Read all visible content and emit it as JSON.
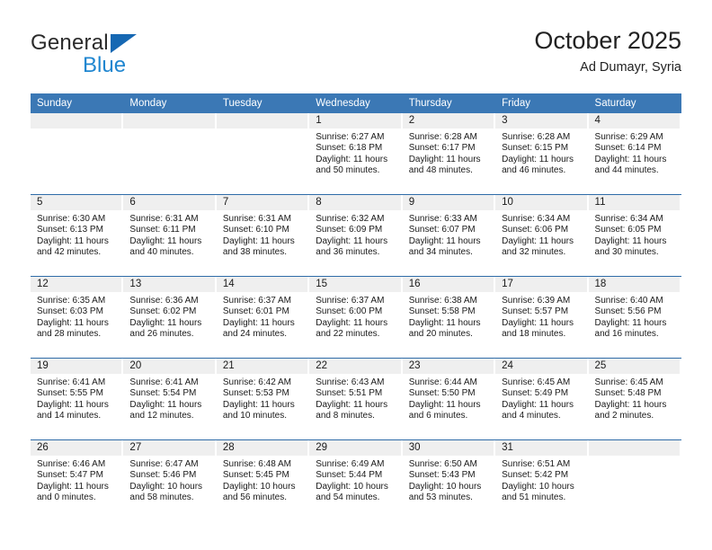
{
  "brand": {
    "name_top": "General",
    "name_bottom": "Blue",
    "accent_dark": "#1668b3",
    "accent_light": "#1f86d0"
  },
  "header": {
    "title": "October 2025",
    "subtitle": "Ad Dumayr, Syria"
  },
  "theme": {
    "header_blue": "#3b78b5",
    "row_divider_blue": "#2f6ca8",
    "day_band_gray": "#efefef"
  },
  "weekdays": [
    "Sunday",
    "Monday",
    "Tuesday",
    "Wednesday",
    "Thursday",
    "Friday",
    "Saturday"
  ],
  "weeks": [
    [
      {
        "day": "",
        "empty": true
      },
      {
        "day": "",
        "empty": true
      },
      {
        "day": "",
        "empty": true
      },
      {
        "day": "1",
        "sunrise": "Sunrise: 6:27 AM",
        "sunset": "Sunset: 6:18 PM",
        "daylight_1": "Daylight: 11 hours",
        "daylight_2": "and 50 minutes."
      },
      {
        "day": "2",
        "sunrise": "Sunrise: 6:28 AM",
        "sunset": "Sunset: 6:17 PM",
        "daylight_1": "Daylight: 11 hours",
        "daylight_2": "and 48 minutes."
      },
      {
        "day": "3",
        "sunrise": "Sunrise: 6:28 AM",
        "sunset": "Sunset: 6:15 PM",
        "daylight_1": "Daylight: 11 hours",
        "daylight_2": "and 46 minutes."
      },
      {
        "day": "4",
        "sunrise": "Sunrise: 6:29 AM",
        "sunset": "Sunset: 6:14 PM",
        "daylight_1": "Daylight: 11 hours",
        "daylight_2": "and 44 minutes."
      }
    ],
    [
      {
        "day": "5",
        "sunrise": "Sunrise: 6:30 AM",
        "sunset": "Sunset: 6:13 PM",
        "daylight_1": "Daylight: 11 hours",
        "daylight_2": "and 42 minutes."
      },
      {
        "day": "6",
        "sunrise": "Sunrise: 6:31 AM",
        "sunset": "Sunset: 6:11 PM",
        "daylight_1": "Daylight: 11 hours",
        "daylight_2": "and 40 minutes."
      },
      {
        "day": "7",
        "sunrise": "Sunrise: 6:31 AM",
        "sunset": "Sunset: 6:10 PM",
        "daylight_1": "Daylight: 11 hours",
        "daylight_2": "and 38 minutes."
      },
      {
        "day": "8",
        "sunrise": "Sunrise: 6:32 AM",
        "sunset": "Sunset: 6:09 PM",
        "daylight_1": "Daylight: 11 hours",
        "daylight_2": "and 36 minutes."
      },
      {
        "day": "9",
        "sunrise": "Sunrise: 6:33 AM",
        "sunset": "Sunset: 6:07 PM",
        "daylight_1": "Daylight: 11 hours",
        "daylight_2": "and 34 minutes."
      },
      {
        "day": "10",
        "sunrise": "Sunrise: 6:34 AM",
        "sunset": "Sunset: 6:06 PM",
        "daylight_1": "Daylight: 11 hours",
        "daylight_2": "and 32 minutes."
      },
      {
        "day": "11",
        "sunrise": "Sunrise: 6:34 AM",
        "sunset": "Sunset: 6:05 PM",
        "daylight_1": "Daylight: 11 hours",
        "daylight_2": "and 30 minutes."
      }
    ],
    [
      {
        "day": "12",
        "sunrise": "Sunrise: 6:35 AM",
        "sunset": "Sunset: 6:03 PM",
        "daylight_1": "Daylight: 11 hours",
        "daylight_2": "and 28 minutes."
      },
      {
        "day": "13",
        "sunrise": "Sunrise: 6:36 AM",
        "sunset": "Sunset: 6:02 PM",
        "daylight_1": "Daylight: 11 hours",
        "daylight_2": "and 26 minutes."
      },
      {
        "day": "14",
        "sunrise": "Sunrise: 6:37 AM",
        "sunset": "Sunset: 6:01 PM",
        "daylight_1": "Daylight: 11 hours",
        "daylight_2": "and 24 minutes."
      },
      {
        "day": "15",
        "sunrise": "Sunrise: 6:37 AM",
        "sunset": "Sunset: 6:00 PM",
        "daylight_1": "Daylight: 11 hours",
        "daylight_2": "and 22 minutes."
      },
      {
        "day": "16",
        "sunrise": "Sunrise: 6:38 AM",
        "sunset": "Sunset: 5:58 PM",
        "daylight_1": "Daylight: 11 hours",
        "daylight_2": "and 20 minutes."
      },
      {
        "day": "17",
        "sunrise": "Sunrise: 6:39 AM",
        "sunset": "Sunset: 5:57 PM",
        "daylight_1": "Daylight: 11 hours",
        "daylight_2": "and 18 minutes."
      },
      {
        "day": "18",
        "sunrise": "Sunrise: 6:40 AM",
        "sunset": "Sunset: 5:56 PM",
        "daylight_1": "Daylight: 11 hours",
        "daylight_2": "and 16 minutes."
      }
    ],
    [
      {
        "day": "19",
        "sunrise": "Sunrise: 6:41 AM",
        "sunset": "Sunset: 5:55 PM",
        "daylight_1": "Daylight: 11 hours",
        "daylight_2": "and 14 minutes."
      },
      {
        "day": "20",
        "sunrise": "Sunrise: 6:41 AM",
        "sunset": "Sunset: 5:54 PM",
        "daylight_1": "Daylight: 11 hours",
        "daylight_2": "and 12 minutes."
      },
      {
        "day": "21",
        "sunrise": "Sunrise: 6:42 AM",
        "sunset": "Sunset: 5:53 PM",
        "daylight_1": "Daylight: 11 hours",
        "daylight_2": "and 10 minutes."
      },
      {
        "day": "22",
        "sunrise": "Sunrise: 6:43 AM",
        "sunset": "Sunset: 5:51 PM",
        "daylight_1": "Daylight: 11 hours",
        "daylight_2": "and 8 minutes."
      },
      {
        "day": "23",
        "sunrise": "Sunrise: 6:44 AM",
        "sunset": "Sunset: 5:50 PM",
        "daylight_1": "Daylight: 11 hours",
        "daylight_2": "and 6 minutes."
      },
      {
        "day": "24",
        "sunrise": "Sunrise: 6:45 AM",
        "sunset": "Sunset: 5:49 PM",
        "daylight_1": "Daylight: 11 hours",
        "daylight_2": "and 4 minutes."
      },
      {
        "day": "25",
        "sunrise": "Sunrise: 6:45 AM",
        "sunset": "Sunset: 5:48 PM",
        "daylight_1": "Daylight: 11 hours",
        "daylight_2": "and 2 minutes."
      }
    ],
    [
      {
        "day": "26",
        "sunrise": "Sunrise: 6:46 AM",
        "sunset": "Sunset: 5:47 PM",
        "daylight_1": "Daylight: 11 hours",
        "daylight_2": "and 0 minutes."
      },
      {
        "day": "27",
        "sunrise": "Sunrise: 6:47 AM",
        "sunset": "Sunset: 5:46 PM",
        "daylight_1": "Daylight: 10 hours",
        "daylight_2": "and 58 minutes."
      },
      {
        "day": "28",
        "sunrise": "Sunrise: 6:48 AM",
        "sunset": "Sunset: 5:45 PM",
        "daylight_1": "Daylight: 10 hours",
        "daylight_2": "and 56 minutes."
      },
      {
        "day": "29",
        "sunrise": "Sunrise: 6:49 AM",
        "sunset": "Sunset: 5:44 PM",
        "daylight_1": "Daylight: 10 hours",
        "daylight_2": "and 54 minutes."
      },
      {
        "day": "30",
        "sunrise": "Sunrise: 6:50 AM",
        "sunset": "Sunset: 5:43 PM",
        "daylight_1": "Daylight: 10 hours",
        "daylight_2": "and 53 minutes."
      },
      {
        "day": "31",
        "sunrise": "Sunrise: 6:51 AM",
        "sunset": "Sunset: 5:42 PM",
        "daylight_1": "Daylight: 10 hours",
        "daylight_2": "and 51 minutes."
      },
      {
        "day": "",
        "empty": true
      }
    ]
  ]
}
